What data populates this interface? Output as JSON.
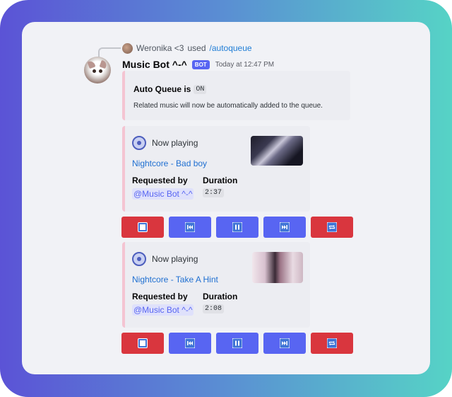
{
  "reply": {
    "user": "Weronika <3",
    "used": "used",
    "command": "/autoqueue"
  },
  "message": {
    "bot_name": "Music Bot ^-^",
    "bot_tag": "BOT",
    "timestamp": "Today at 12:47 PM"
  },
  "autoqueue_embed": {
    "title": "Auto Queue is",
    "state": "ON",
    "description": "Related music will now be automatically added to the queue."
  },
  "now_playing": [
    {
      "header": "Now playing",
      "song": "Nightcore - Bad boy",
      "requested_by_label": "Requested by",
      "requested_by": "@Music Bot ^-^",
      "duration_label": "Duration",
      "duration": "2:37"
    },
    {
      "header": "Now playing",
      "song": "Nightcore - Take A Hint",
      "requested_by_label": "Requested by",
      "requested_by": "@Music Bot ^-^",
      "duration_label": "Duration",
      "duration": "2:08"
    }
  ],
  "controls": [
    "stop",
    "previous",
    "pause",
    "next",
    "loop"
  ],
  "colors": {
    "accent": "#5865f2",
    "danger": "#d9363e",
    "link": "#1f6fd1",
    "embed_border": "#f4c4d2"
  }
}
